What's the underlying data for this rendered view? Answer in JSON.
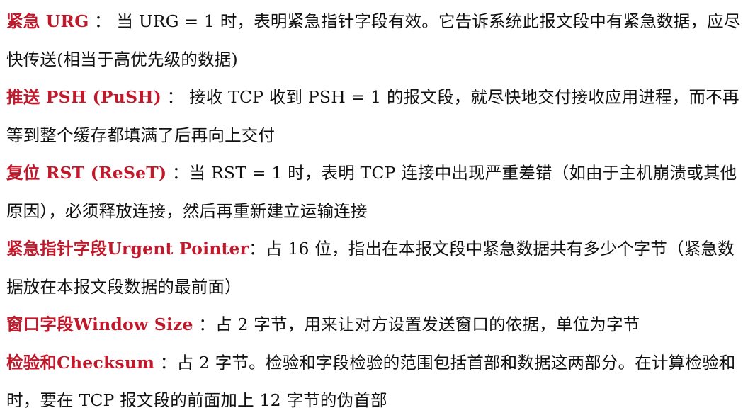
{
  "items": [
    {
      "term": "紧急 URG",
      "text": " ： 当 URG = 1 时，表明紧急指针字段有效。它告诉系统此报文段中有紧急数据，应尽快传送(相当于高优先级的数据)"
    },
    {
      "term": "推送 PSH (PuSH)",
      "text": " ： 接收 TCP 收到 PSH = 1 的报文段，就尽快地交付接收应用进程，而不再等到整个缓存都填满了后再向上交付"
    },
    {
      "term": "复位 RST (ReSeT)",
      "text": " ：当 RST = 1 时，表明 TCP 连接中出现严重差错（如由于主机崩溃或其他原因），必须释放连接，然后再重新建立运输连接"
    },
    {
      "term": "紧急指针字段Urgent Pointer",
      "text": "：占 16 位，指出在本报文段中紧急数据共有多少个字节（紧急数据放在本报文段数据的最前面）"
    },
    {
      "term": "窗口字段Window Size",
      "text": " ：占 2 字节，用来让对方设置发送窗口的依据，单位为字节"
    },
    {
      "term": "检验和Checksum",
      "text": " ：占 2 字节。检验和字段检验的范围包括首部和数据这两部分。在计算检验和时，要在 TCP 报文段的前面加上 12 字节的伪首部"
    }
  ],
  "colors": {
    "term": "#c0192b",
    "text": "#111111"
  }
}
